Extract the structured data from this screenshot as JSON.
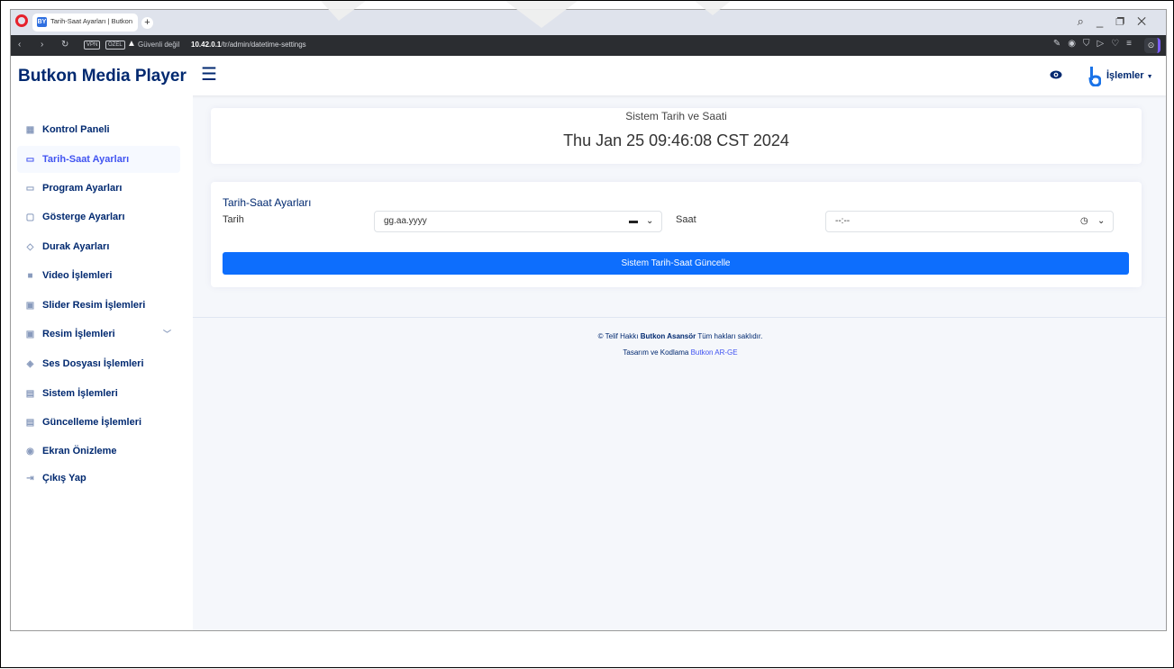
{
  "browser": {
    "tab_title": "Tarih-Saat Ayarları | Butkon",
    "tab_favicon": "BY",
    "security_label": "Güvenli değil",
    "vpn_badge": "VPN",
    "private_badge": "ÖZEL",
    "url_host": "10.42.0.1",
    "url_path": "/tr/admin/datetime-settings"
  },
  "header": {
    "brand": "Butkon Media Player",
    "user_menu_label": "İşlemler"
  },
  "sidebar": {
    "items": [
      {
        "label": "Kontrol Paneli",
        "icon": "grid-icon"
      },
      {
        "label": "Tarih-Saat Ayarları",
        "icon": "calendar-icon"
      },
      {
        "label": "Program Ayarları",
        "icon": "monitor-icon"
      },
      {
        "label": "Gösterge Ayarları",
        "icon": "display-icon"
      },
      {
        "label": "Durak Ayarları",
        "icon": "location-icon"
      },
      {
        "label": "Video İşlemleri",
        "icon": "video-icon"
      },
      {
        "label": "Slider Resim İşlemleri",
        "icon": "image-icon"
      },
      {
        "label": "Resim İşlemleri",
        "icon": "image-icon"
      },
      {
        "label": "Ses Dosyası İşlemleri",
        "icon": "audio-icon"
      },
      {
        "label": "Sistem İşlemleri",
        "icon": "terminal-icon"
      },
      {
        "label": "Güncelleme İşlemleri",
        "icon": "terminal-icon"
      },
      {
        "label": "Ekran Önizleme",
        "icon": "eye-icon"
      },
      {
        "label": "Çıkış Yap",
        "icon": "logout-icon"
      }
    ],
    "active_item": "Tarih-Saat Ayarları"
  },
  "system_time": {
    "title": "Sistem Tarih ve Saati",
    "value": "Thu Jan 25 09:46:08 CST 2024"
  },
  "form": {
    "title": "Tarih-Saat Ayarları",
    "date_label": "Tarih",
    "date_placeholder": "gg.aa.yyyy",
    "time_label": "Saat",
    "time_placeholder": "--:--",
    "submit_label": "Sistem Tarih-Saat Güncelle"
  },
  "footer": {
    "copyright_prefix": "© Telif Hakkı",
    "company": "Butkon Asansör",
    "rights": "Tüm hakları saklıdır.",
    "design_prefix": "Tasarım ve Kodlama",
    "design_link": "Butkon AR-GE"
  },
  "colors": {
    "brand": "#012970",
    "accent": "#4154f1",
    "primary_button": "#0d6efd"
  }
}
